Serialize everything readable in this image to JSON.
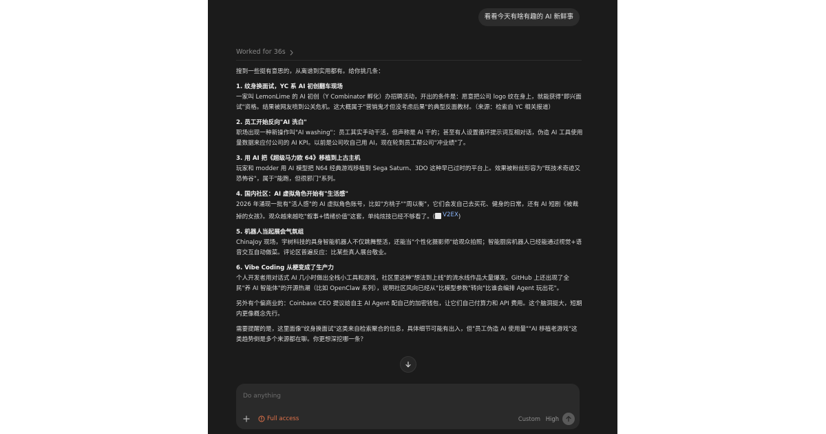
{
  "conversation": {
    "user_message": "看看今天有啥有趣的 AI 新鲜事",
    "worked_label": "Worked for 36s",
    "intro": "搜到一些挺有意思的，从离谱到实用都有。给你挑几条：",
    "items": [
      {
        "title": "1. 纹身换面试，YC 系 AI 初创翻车现场",
        "body": "一家叫 LemonLime 的 AI 初创（Y Combinator 孵化）办招聘活动，开出的条件是：愿意把公司 logo 纹在身上，就能获得\"即兴面试\"资格。结果被网友喷到公关危机。这大概属于\"营销鬼才但没考虑后果\"的典型反面教材。（来源：检索自 YC 相关报道）"
      },
      {
        "title": "2. 员工开始反向\"AI 洗白\"",
        "body": "职场出现一种新操作叫\"AI washing\"：员工其实手动干活，但声称是 AI 干的；甚至有人设置循环提示词互相对话，伪造 AI 工具使用量数据来应付公司的 AI KPI。以前是公司吹自己用 AI，现在轮到员工帮公司\"冲业绩\"了。"
      },
      {
        "title": "3. 用 AI 把《超级马力欧 64》移植到上古主机",
        "body": "玩家和 modder 用 AI 模型把 N64 经典游戏移植到 Sega Saturn、3DO 这种早已过时的平台上。效果被粉丝形容为\"既技术奇迹又恐怖谷\"，属于\"能跑，但很邪门\"系列。"
      },
      {
        "title": "4. 国内社区：AI 虚拟角色开始有\"生活感\"",
        "body": "2026 年涌现一批有\"活人感\"的 AI 虚拟角色账号，比如\"方桃子\"\"周以衡\"，它们会发自己去买花、健身的日常，还有 AI 短剧《被裁掉的女孩》。观众越来越吃\"叙事+情绪价值\"这套，单纯炫技已经不够看了。(",
        "source": "V2EX",
        "suffix": ")"
      },
      {
        "title": "5. 机器人当起展会气氛组",
        "body": "ChinaJoy 现场，宇树科技的具身智能机器人不仅跳舞整活，还能当\"个性化摄影师\"给观众拍照；智能厨房机器人已经能通过视觉+语音交互自动做菜。评论区普遍反应：比某些真人展台敬业。"
      },
      {
        "title": "6. Vibe Coding 从梗变成了生产力",
        "body": "个人开发者用对话式 AI 几小时做出全栈小工具和游戏，社区里这种\"想法到上线\"的流水线作品大量爆发。GitHub 上还出现了全民\"养 AI 智能体\"的开源热潮（比如 OpenClaw 系列），说明社区风向已经从\"比模型参数\"转向\"比谁会编排 Agent 玩出花\"。"
      }
    ],
    "extra": "另外有个偏商业的：Coinbase CEO 提议给自主 AI Agent 配自己的加密钱包，让它们自己付算力和 API 费用。这个脑洞挺大，短期内更像概念先行。",
    "closing": "需要提醒的是，这里面像\"纹身换面试\"这类来自检索聚合的信息，具体细节可能有出入，但\"员工伪造 AI 使用量\"\"AI 移植老游戏\"这类趋势倒是多个来源都在聊。你更想深挖哪一条？"
  },
  "composer": {
    "placeholder": "Do anything",
    "access_label": "Full access",
    "mode_label": "Custom",
    "level_label": "High"
  },
  "icons": {
    "worked": "chevron-right-icon",
    "scroll": "arrow-down-icon",
    "add": "plus-icon",
    "access": "warning-circle-icon",
    "send": "arrow-up-icon",
    "source": "v2ex-logo-icon"
  },
  "colors": {
    "background": "#1b1b1b",
    "text": "#dcdcdc",
    "muted": "#8a8a8a",
    "access": "#e0724a",
    "link": "#8ab4f8",
    "composer": "#2a2a2a"
  }
}
